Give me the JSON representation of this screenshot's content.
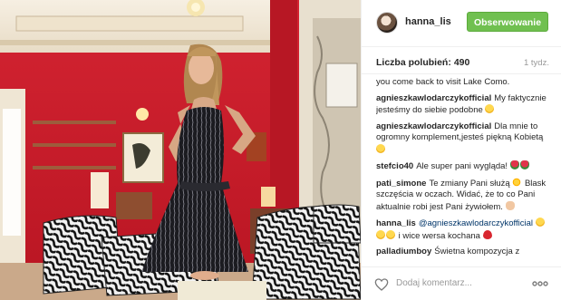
{
  "header": {
    "username": "hanna_lis",
    "follow_label": "Obserwowanie"
  },
  "stats": {
    "likes_label": "Liczba polubień:",
    "likes_count": "490",
    "age": "1 tydz."
  },
  "comments": [
    {
      "author": "",
      "text": "you come back to visit Lake Como."
    },
    {
      "author": "agnieszkawlodarczykofficial",
      "text": "My faktycznie jesteśmy do siebie podobne",
      "emoji": [
        "face"
      ]
    },
    {
      "author": "agnieszkawlodarczykofficial",
      "text": "Dla mnie to ogromny komplement,jesteś piękną Kobietą",
      "emoji": [
        "face"
      ]
    },
    {
      "author": "stefcio40",
      "text": "Ale super pani wygląda!",
      "emoji": [
        "rose",
        "rose"
      ]
    },
    {
      "author": "pati_simone",
      "text": "Te zmiany Pani służą",
      "text2": "Blask szczęścia w oczach. Widać, że to co Pani aktualnie robi jest Pani żywiołem.",
      "emoji_mid": [
        "sun"
      ],
      "emoji": [
        "hand"
      ]
    },
    {
      "author": "hanna_lis",
      "mention": "@agnieszkawlodarczykofficial",
      "text": "i wice wersa kochana",
      "emoji_pre": [
        "face",
        "face",
        "face"
      ],
      "emoji": [
        "heart"
      ]
    },
    {
      "author": "palladiumboy",
      "text": "Świetna kompozycja z"
    }
  ],
  "footer": {
    "add_comment_placeholder": "Dodaj komentarz...",
    "like_icon": "heart-outline-icon",
    "more_icon": "ellipsis-icon"
  },
  "colors": {
    "follow_green": "#70c050",
    "wall_red": "#c81c2a",
    "mention_blue": "#003569"
  }
}
